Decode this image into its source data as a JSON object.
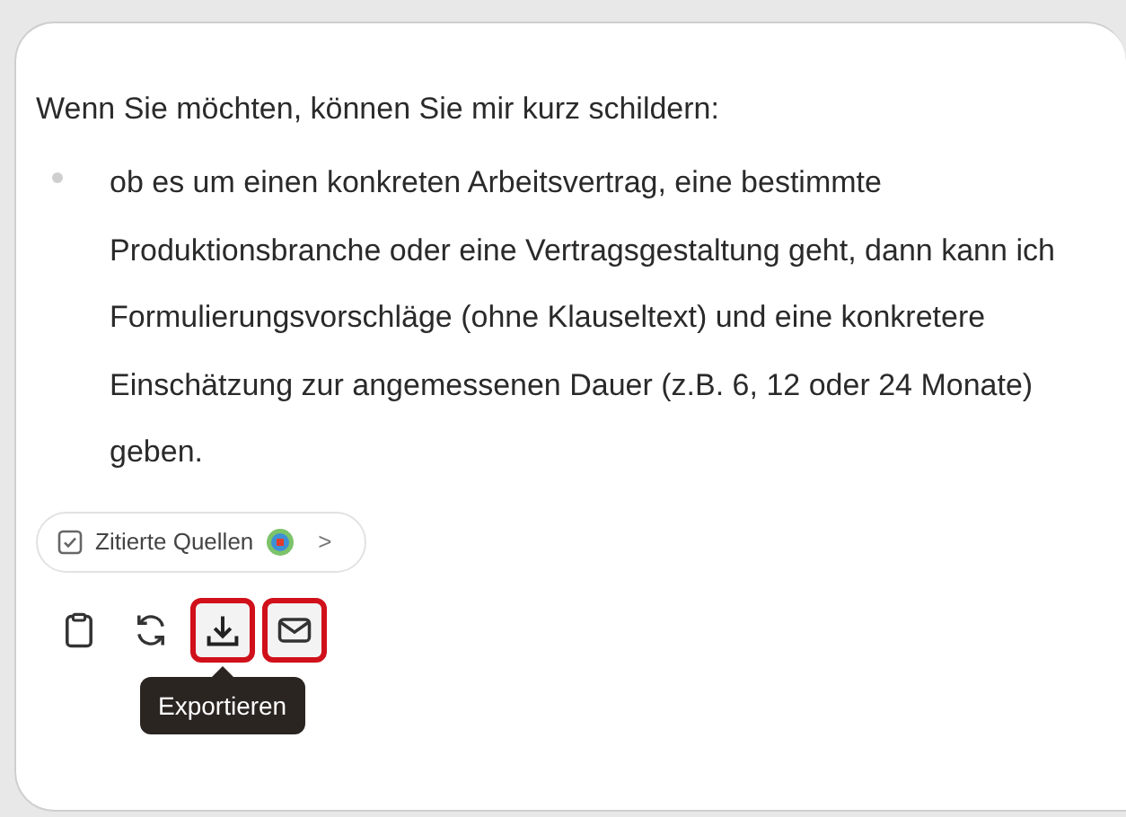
{
  "message": {
    "intro": "Wenn Sie möchten, können Sie mir kurz schildern:",
    "bullets": [
      "ob es um einen konkreten Arbeitsvertrag, eine bestimmte Produktionsbranche oder eine Vertragsgestaltung geht, dann kann ich Formulierungsvorschläge (ohne Klauseltext) und eine konkretere Einschätzung zur angemessenen Dauer (z.B. 6, 12 oder 24 Monate) geben."
    ]
  },
  "sources_chip": {
    "label": "Zitierte Quellen",
    "chevron": ">"
  },
  "actions": [
    {
      "kind": "copy",
      "highlighted": false
    },
    {
      "kind": "regenerate",
      "highlighted": false
    },
    {
      "kind": "export",
      "highlighted": true,
      "tooltip": "Exportieren"
    },
    {
      "kind": "mail",
      "highlighted": true
    }
  ]
}
